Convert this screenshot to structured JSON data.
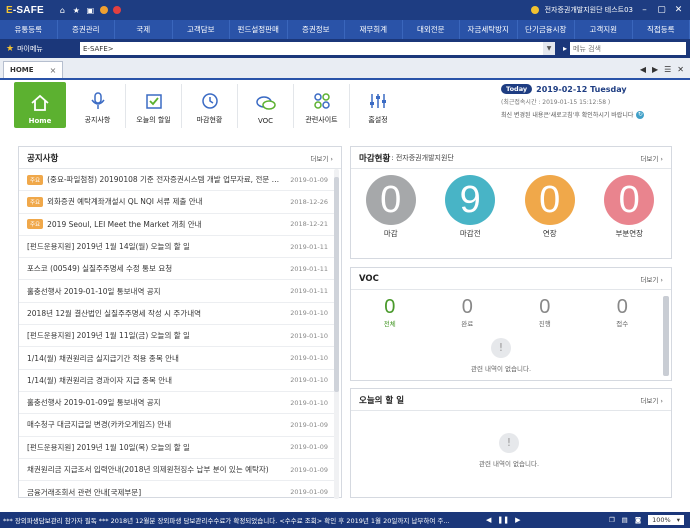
{
  "app": {
    "logo_prefix": "E",
    "logo_rest": "-SAFE"
  },
  "titlebar": {
    "user": "전자증권개발지원단 테스트03"
  },
  "menu": [
    "유통등록",
    "증권관리",
    "국제",
    "고객담보",
    "펀드설정판매",
    "증권정보",
    "재무회계",
    "대외전문",
    "자금세탁방지",
    "단기금융시장",
    "고객지원",
    "직접등록"
  ],
  "bookmark": {
    "label": "마이메뉴",
    "path": "E-SAFE>",
    "search_placeholder": "메뉴 검색"
  },
  "tab": {
    "label": "HOME"
  },
  "quick": [
    {
      "label": "Home",
      "icon": "home-icon"
    },
    {
      "label": "공지사항",
      "icon": "microphone-icon"
    },
    {
      "label": "오늘의 할일",
      "icon": "checklist-icon"
    },
    {
      "label": "마감현황",
      "icon": "clock-icon"
    },
    {
      "label": "VOC",
      "icon": "chat-icon"
    },
    {
      "label": "관련사이트",
      "icon": "grid-icon"
    },
    {
      "label": "홈설정",
      "icon": "sliders-icon"
    }
  ],
  "today": {
    "badge": "Today",
    "date": "2019-02-12 Tuesday",
    "recent": "(최근접속시간 : 2019-01-15 15:12:58 )",
    "notice": "최신 변경된 내용은'새로고침'후 확인하시기 바랍니다"
  },
  "notices": {
    "title": "공지사항",
    "more": "더보기",
    "items": [
      {
        "badge": "주요",
        "text": "(중요-파일첨정) 20190108 기준 전자증권시스템 개발 업무자료, 전문 및...",
        "date": "2019-01-09"
      },
      {
        "badge": "주요",
        "text": "외화증권 예탁계좌개설시 QL NQI 서류 제출 안내",
        "date": "2018-12-26"
      },
      {
        "badge": "주요",
        "text": "2019 Seoul, LEI Meet the Market 개최 안내",
        "date": "2018-12-21"
      },
      {
        "badge": "",
        "text": "[펀드운용지원] 2019년 1월 14일(월) 오늘의 할 일",
        "date": "2019-01-11"
      },
      {
        "badge": "",
        "text": "포스코 (00549) 실질주주명세 수정 통보 요청",
        "date": "2019-01-11"
      },
      {
        "badge": "",
        "text": "홀충선행사 2019-01-10일 통보내역 공지",
        "date": "2019-01-11"
      },
      {
        "badge": "",
        "text": "2018년 12월 결산법인 실질주주명세 작성 시 주가내역",
        "date": "2019-01-10"
      },
      {
        "badge": "",
        "text": "[펀드운용지원] 2019년 1월 11일(금) 오늘의 할 일",
        "date": "2019-01-10"
      },
      {
        "badge": "",
        "text": "1/14(월) 채권원리금 실지급기간 적용 종목 안내",
        "date": "2019-01-10"
      },
      {
        "badge": "",
        "text": "1/14(월) 채권원리금 경과이자 지급 종목 안내",
        "date": "2019-01-10"
      },
      {
        "badge": "",
        "text": "홀충선행사 2019-01-09일 통보내역 공지",
        "date": "2019-01-10"
      },
      {
        "badge": "",
        "text": "매수청구 대금지급일 변경(카카오게임즈) 안내",
        "date": "2019-01-09"
      },
      {
        "badge": "",
        "text": "[펀드운용지원] 2019년 1월 10일(목) 오늘의 할 일",
        "date": "2019-01-09"
      },
      {
        "badge": "",
        "text": "채권원리금 지급조서 입력안내(2018년 의제원천징수 납부 분이 있는 예탁자)",
        "date": "2019-01-09"
      },
      {
        "badge": "",
        "text": "금융거래조회서 관련 안내[국제부문]",
        "date": "2019-01-09"
      }
    ]
  },
  "deadline": {
    "title": "마감현황",
    "subtitle": ": 전자증권개발지원단",
    "more": "더보기",
    "items": [
      {
        "label": "마감",
        "value": "0",
        "color": "#a6a8aa"
      },
      {
        "label": "마감전",
        "value": "9",
        "color": "#48b4c6"
      },
      {
        "label": "연장",
        "value": "0",
        "color": "#f0a84a"
      },
      {
        "label": "부분연장",
        "value": "0",
        "color": "#e9848e"
      }
    ]
  },
  "voc": {
    "title": "VOC",
    "more": "더보기",
    "stats": [
      {
        "label": "전체",
        "value": "0"
      },
      {
        "label": "완료",
        "value": "0"
      },
      {
        "label": "진행",
        "value": "0"
      },
      {
        "label": "접수",
        "value": "0"
      }
    ],
    "empty": "관련 내역이 없습니다."
  },
  "todo": {
    "title": "오늘의 할 일",
    "more": "더보기",
    "empty": "관련 내역이 없습니다."
  },
  "status": {
    "ticker": "*** 장외파생담보관리 참가자 필독 ***  2018년 12월분 장외파생 담보관리수수료가 확정되었습니다. <수수료 조회> 확인 후 2019년 1월 20일까지 납부하여 주...",
    "zoom": "100%"
  }
}
